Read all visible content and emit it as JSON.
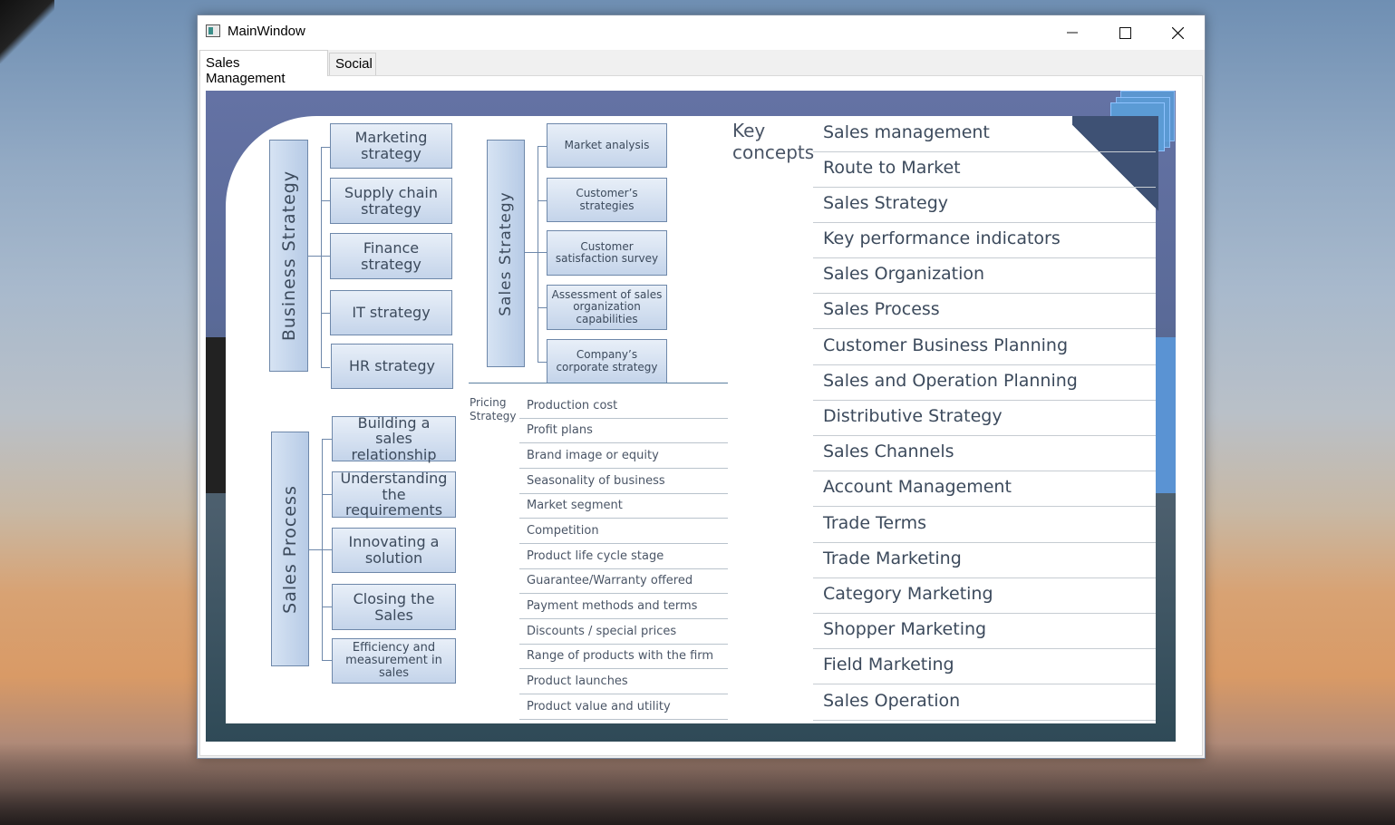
{
  "window": {
    "title": "MainWindow",
    "controls": {
      "minimize": "minimize-icon",
      "maximize": "maximize-icon",
      "close": "close-icon"
    }
  },
  "tabs": [
    {
      "label": "Sales Management",
      "active": true
    },
    {
      "label": "Social",
      "active": false
    }
  ],
  "slide": {
    "business_strategy": {
      "title": "Business   Strategy",
      "items": [
        "Marketing strategy",
        "Supply chain strategy",
        "Finance strategy",
        "IT strategy",
        "HR strategy"
      ]
    },
    "sales_strategy": {
      "title": "Sales   Strategy",
      "items": [
        "Market analysis",
        "Customer’s strategies",
        "Customer satisfaction survey",
        "Assessment of sales organization capabilities",
        "Company’s corporate strategy"
      ]
    },
    "sales_process": {
      "title": "Sales Process",
      "items": [
        "Building a sales relationship",
        "Understanding the requirements",
        "Innovating a solution",
        "Closing the Sales",
        "Efficiency and measurement  in sales"
      ]
    },
    "pricing_strategy": {
      "label_line1": "Pricing",
      "label_line2": "Strategy",
      "items": [
        "Production cost",
        "Profit plans",
        "Brand image or equity",
        "Seasonality of business",
        "Market segment",
        "Competition",
        "Product life cycle stage",
        "Guarantee/Warranty  offered",
        "Payment methods and terms",
        "Discounts  /  special prices",
        "Range of products with the firm",
        "Product launches",
        "Product value and utility"
      ]
    },
    "key_concepts": {
      "label_line1": "Key",
      "label_line2": "concepts",
      "items": [
        "Sales management",
        "Route to Market",
        "Sales Strategy",
        "Key performance indicators",
        "Sales Organization",
        "Sales Process",
        "Customer Business Planning",
        "Sales and Operation Planning",
        "Distributive Strategy",
        "Sales Channels",
        "Account Management",
        "Trade Terms",
        "Trade Marketing",
        "Category Marketing",
        "Shopper Marketing",
        "Field Marketing",
        "Sales Operation"
      ]
    }
  }
}
